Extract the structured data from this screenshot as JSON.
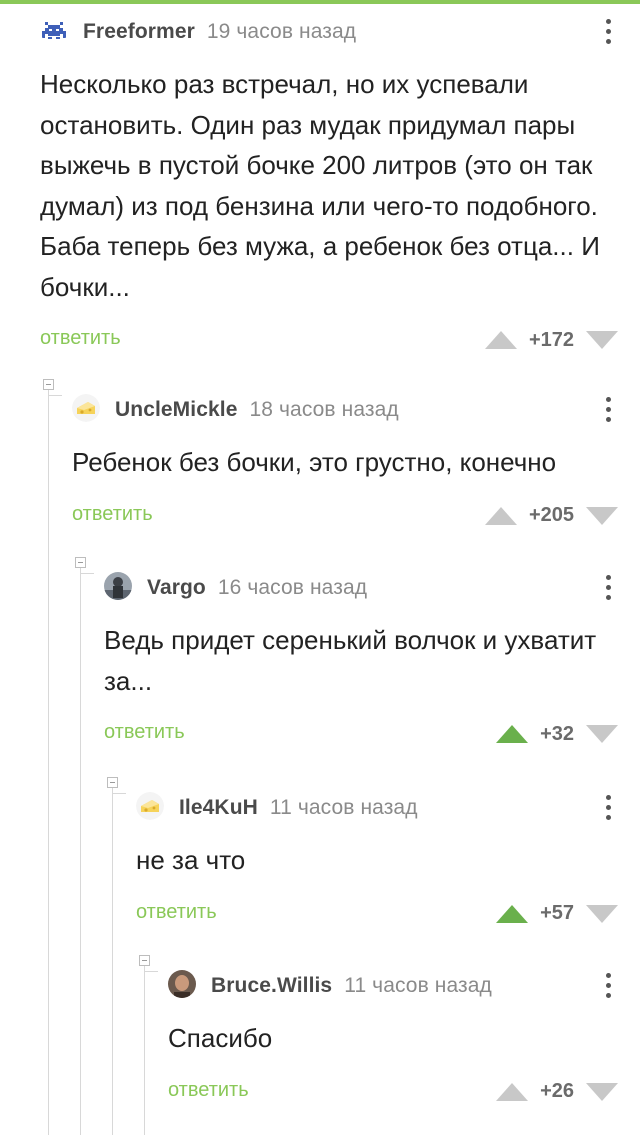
{
  "reply_label": "ответить",
  "comments": [
    {
      "author": "Freeformer",
      "time": "19 часов назад",
      "text": "Несколько раз встречал, но их успевали остановить. Один раз мудак придумал пары выжечь в пустой бочке 200 литров (это он так думал) из под бензина или чего-то подобного. Баба теперь без мужа, а ребенок без отца... И бочки...",
      "score": "+172",
      "upvoted": false
    },
    {
      "author": "UncleMickle",
      "time": "18 часов назад",
      "text": "Ребенок без бочки, это грустно, конечно",
      "score": "+205",
      "upvoted": false
    },
    {
      "author": "Vargo",
      "time": "16 часов назад",
      "text": "Ведь придет серенький волчок и ухватит за...",
      "score": "+32",
      "upvoted": true
    },
    {
      "author": "Ile4KuH",
      "time": "11 часов назад",
      "text": "не за что",
      "score": "+57",
      "upvoted": true
    },
    {
      "author": "Bruce.Willis",
      "time": "11 часов назад",
      "text": "Спасибо",
      "score": "+26",
      "upvoted": false
    }
  ],
  "colors": {
    "accent": "#8ac858",
    "vote_inactive": "#c8c8c8",
    "text": "#222222",
    "muted": "#8a8a8a"
  },
  "icons": [
    "space-invader-icon",
    "cheese-icon",
    "user-photo",
    "more-vertical-icon",
    "arrow-up-icon",
    "arrow-down-icon",
    "collapse-icon"
  ]
}
